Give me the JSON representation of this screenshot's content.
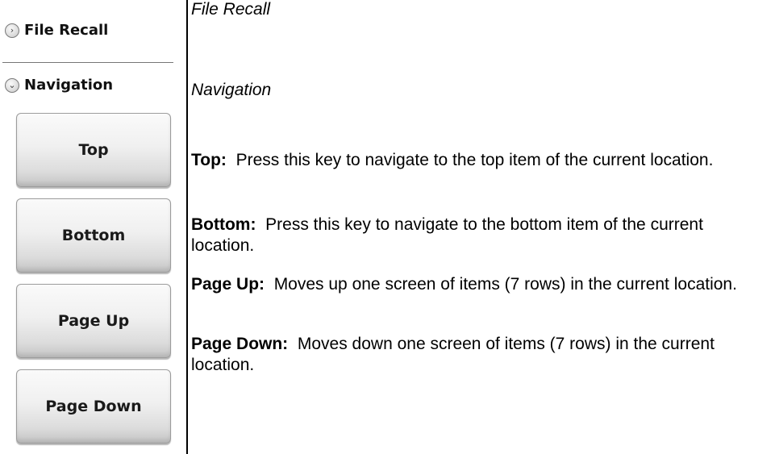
{
  "sidebar": {
    "file_recall": {
      "label": "File Recall",
      "icon": "chevron-right-circle-icon"
    },
    "navigation": {
      "label": "Navigation",
      "icon": "chevron-down-circle-icon"
    },
    "keys": [
      {
        "label": "Top"
      },
      {
        "label": "Bottom"
      },
      {
        "label": "Page Up"
      },
      {
        "label": "Page Down"
      }
    ]
  },
  "content": {
    "file_recall_heading": "File Recall",
    "navigation_heading": "Navigation",
    "descriptions": [
      {
        "term": "Top:",
        "text": "Press this key to navigate to the top item of the current location."
      },
      {
        "term": "Bottom:",
        "text": "Press this key to navigate to the bottom item of the current location."
      },
      {
        "term": "Page Up:",
        "text": "Moves up one screen of items (7 rows) in the current location."
      },
      {
        "term": "Page Down:",
        "text": "Moves down one screen of items (7 rows) in the current location."
      }
    ]
  }
}
